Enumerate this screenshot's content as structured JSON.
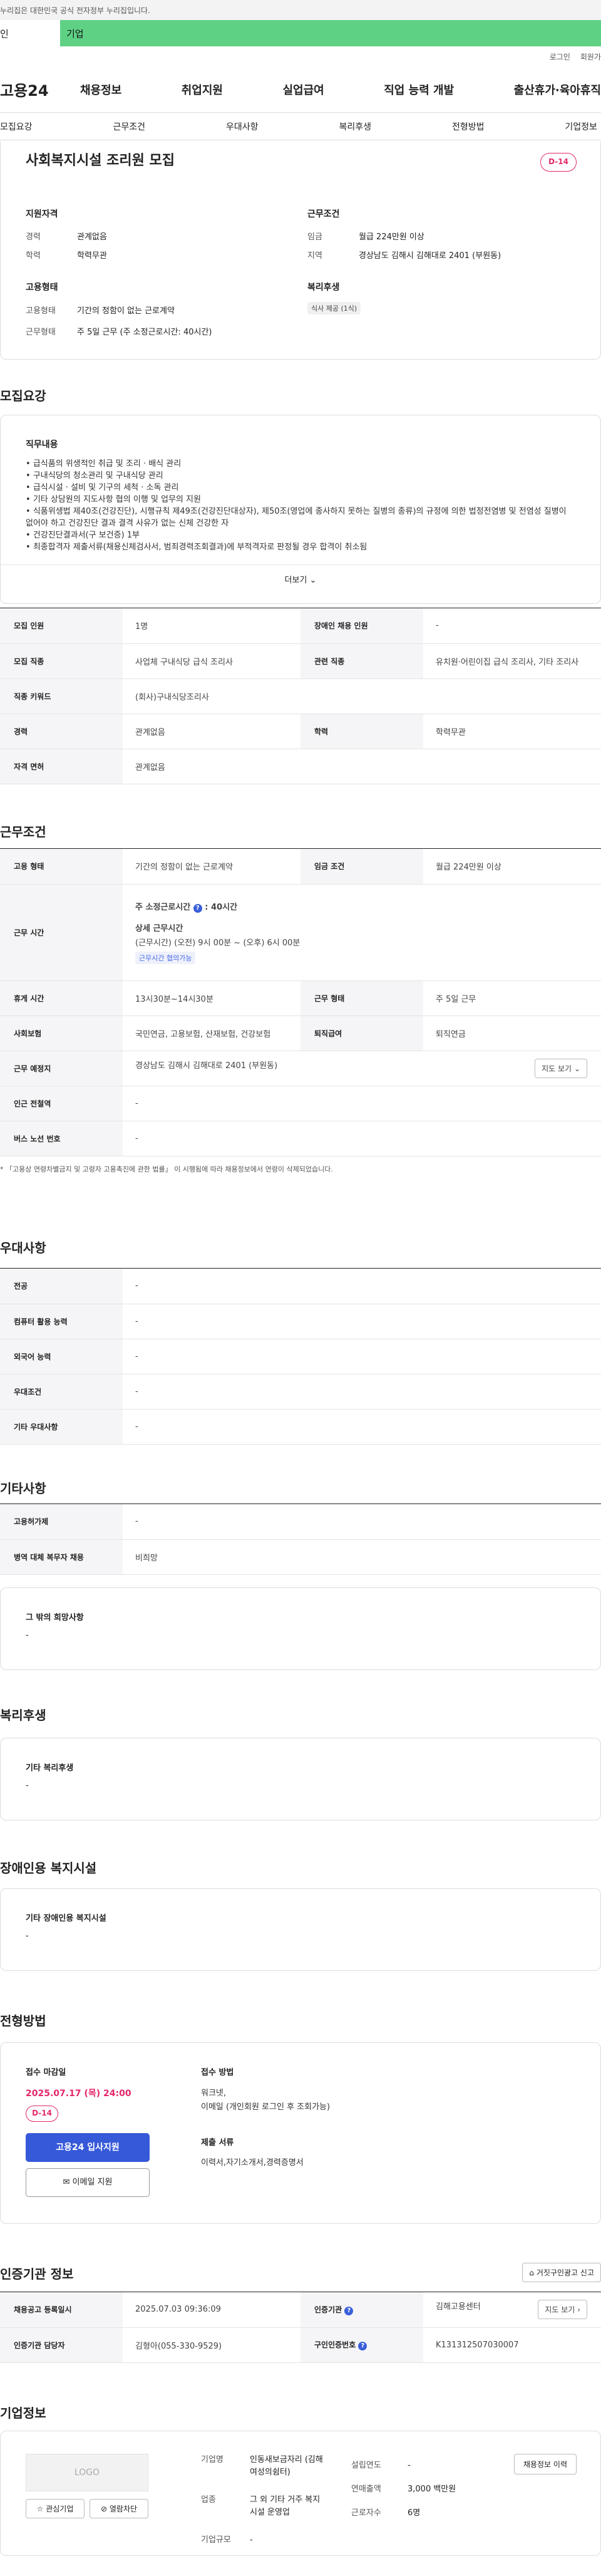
{
  "gov_notice": "이 누리집은 대한민국 공식 전자정부 누리집입니다.",
  "gov_notice_visible": "누리집은 대한민국 공식 전자정부 누리집입니다.",
  "type_tabs": {
    "individual": "인",
    "corporate": "기업"
  },
  "top_links": {
    "login": "로그인",
    "signup": "회원가"
  },
  "logo": "고용24",
  "gnb": [
    "채용정보",
    "취업지원",
    "실업급여",
    "직업 능력 개발",
    "출산휴가·육아휴직"
  ],
  "subnav": [
    "모집요강",
    "근무조건",
    "우대사항",
    "복리후생",
    "전형방법",
    "기업정보"
  ],
  "summary": {
    "title": "사회복지시설 조리원 모집",
    "dday": "D-14",
    "qual_title": "지원자격",
    "qual": [
      {
        "label": "경력",
        "value": "관계없음"
      },
      {
        "label": "학력",
        "value": "학력무관"
      }
    ],
    "cond_title": "근무조건",
    "cond": [
      {
        "label": "임금",
        "value": "월급 224만원 이상"
      },
      {
        "label": "지역",
        "value": "경상남도 김해시 김해대로 2401 (부원동)"
      }
    ],
    "emp_title": "고용형태",
    "emp": [
      {
        "label": "고용형태",
        "value": "기간의 정함이 없는 근로계약"
      },
      {
        "label": "근무형태",
        "value": "주 5일 근무 (주 소정근로시간: 40시간)"
      }
    ],
    "welfare_title": "복리후생",
    "welfare_tag": "식사 제공 (1식)"
  },
  "recruit": {
    "title": "모집요강",
    "duty_title": "직무내용",
    "duties": [
      "급식품의 위생적인 취급 및 조리 · 배식 관리",
      "구내식당의 청소관리 및 구내식당 관리",
      "급식시설 · 설비 및 기구의 세척 · 소독 관리",
      "기타 상담원의 지도사항 협의 이행 및 업무의 지원",
      "식품위생법 제40조(건강진단), 시행규칙 제49조(건강진단대상자), 제50조(영업에 종사하지 못하는 질병의 종류)의 규정에 의한 법정전염병 및 전염성 질병이 없어야 하고 건강진단 결과 결격 사유가 없는 신체 건강한 자",
      "건강진단결과서(구 보건증) 1부",
      "최종합격자 제출서류(채용신체검사서, 범죄경력조회결과)에 부적격자로 판정될 경우 합격이 취소됨"
    ],
    "more": "더보기",
    "rows": [
      [
        "모집 인원",
        "1명",
        "장애인 채용 인원",
        "-"
      ],
      [
        "모집 직종",
        "사업체 구내식당 급식 조리사",
        "관련 직종",
        "유치원·어린이집 급식 조리사, 기타 조리사"
      ],
      [
        "직종 키워드",
        "(회사)구내식당조리사",
        "",
        ""
      ],
      [
        "경력",
        "관계없음",
        "학력",
        "학력무관"
      ],
      [
        "자격 면허",
        "관계없음",
        "",
        ""
      ]
    ]
  },
  "work": {
    "title": "근무조건",
    "emp_type_label": "고용 형태",
    "emp_type": "기간의 정함이 없는 근로계약",
    "wage_label": "임금 조건",
    "wage": "월급 224만원 이상",
    "hours_label": "근무 시간",
    "weekly_hours_label": "주 소정근로시간",
    "weekly_hours_value": "40시간",
    "detail_label": "상세 근무시간",
    "detail_lines": [
      "(근무시간) (오전) 9시 00분 ~ (오후) 6시 00분"
    ],
    "hours_tag": "근무시간 협의가능",
    "break_label": "휴게 시간",
    "break": "13시30분~14시30분",
    "shift_label": "근무 형태",
    "shift": "주 5일 근무",
    "insurance_label": "사회보험",
    "insurance": "국민연금, 고용보험, 산재보험, 건강보험",
    "severance_label": "퇴직급여",
    "severance": "퇴직연금",
    "place_label": "근무 예정지",
    "place": "경상남도 김해시 김해대로 2401 (부원동)",
    "map_btn": "지도 보기",
    "station_label": "인근 전철역",
    "station": "-",
    "bus_label": "버스 노선 번호",
    "bus": "-",
    "note": "* 「고용상 연령차별금지 및 고령자 고용촉진에 관한 법률」 이 시행됨에 따라 채용정보에서 연령이 삭제되었습니다."
  },
  "pref": {
    "title": "우대사항",
    "rows": [
      [
        "전공",
        "-"
      ],
      [
        "컴퓨터 활용 능력",
        "-"
      ],
      [
        "외국어 능력",
        "-"
      ],
      [
        "우대조건",
        "-"
      ],
      [
        "기타 우대사항",
        "-"
      ]
    ]
  },
  "etc": {
    "title": "기타사항",
    "rows": [
      [
        "고용허가제",
        "-"
      ],
      [
        "병역 대체 복무자 채용",
        "비희망"
      ]
    ],
    "other_title": "그 밖의 희망사항",
    "other_value": "-"
  },
  "benefit": {
    "title": "복리후생",
    "box_title": "기타 복리후생",
    "box_value": "-"
  },
  "disability": {
    "title": "장애인용 복지시설",
    "box_title": "기타 장애인용 복지시설",
    "box_value": "-"
  },
  "process": {
    "title": "전형방법",
    "deadline_label": "접수 마감일",
    "deadline": "2025.07.17 (목) 24:00",
    "dday": "D-14",
    "apply_btn": "고용24 입사지원",
    "email_btn": "이메일 지원",
    "method_label": "접수 방법",
    "method_lines": [
      "워크넷,",
      "이메일 (개인회원 로그인 후 조회가능)"
    ],
    "docs_label": "제출 서류",
    "docs": "이력서,자기소개서,경력증명서"
  },
  "cert": {
    "title": "인증기관 정보",
    "report_btn": "거짓구인광고 신고",
    "rows": [
      [
        "채용공고 등록일시",
        "2025.07.03 09:36:09",
        "인증기관",
        "김해고용센터"
      ],
      [
        "인증기관 담당자",
        "김형아(055-330-9529)",
        "구인인증번호",
        "K131312507030007"
      ]
    ],
    "map_btn": "지도 보기"
  },
  "company": {
    "title": "기업정보",
    "logo_text": "LOGO",
    "fav_btn": "관심기업",
    "block_btn": "열람차단",
    "name_label": "기업명",
    "name": "인동새보금자리 (김해여성의쉼터)",
    "industry_label": "업종",
    "industry": "그 외 기타 거주 복지시설 운영업",
    "size_label": "기업규모",
    "size": "-",
    "founded_label": "설립연도",
    "founded": "-",
    "sales_label": "연매출액",
    "sales": "3,000 백만원",
    "staff_label": "근로자수",
    "staff": "6명",
    "list_btn": "채용정보 이력"
  }
}
